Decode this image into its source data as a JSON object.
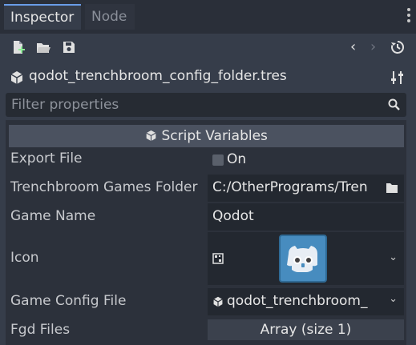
{
  "tabs": [
    {
      "label": "Inspector",
      "active": true
    },
    {
      "label": "Node",
      "active": false
    }
  ],
  "resource": {
    "name": "qodot_trenchbroom_config_folder.tres"
  },
  "filter": {
    "placeholder": "Filter properties"
  },
  "section": {
    "title": "Script Variables"
  },
  "properties": [
    {
      "label": "Export File",
      "value": "On"
    },
    {
      "label": "Trenchbroom Games Folder",
      "value": "C:/OtherPrograms/Tren"
    },
    {
      "label": "Game Name",
      "value": "Qodot"
    },
    {
      "label": "Icon",
      "value": ""
    },
    {
      "label": "Game Config File",
      "value": "qodot_trenchbroom_"
    },
    {
      "label": "Fgd Files",
      "value": "Array (size 1)"
    }
  ],
  "icons": {
    "new_resource": "new-resource-icon",
    "open": "folder-open-icon",
    "save": "save-icon",
    "back": "chevron-left-icon",
    "forward": "chevron-right-icon",
    "history": "history-icon",
    "resource_type": "cube-icon",
    "tools": "tools-icon",
    "search": "search-icon"
  },
  "colors": {
    "accent": "#699ce8",
    "godot_blue": "#478cbf"
  }
}
